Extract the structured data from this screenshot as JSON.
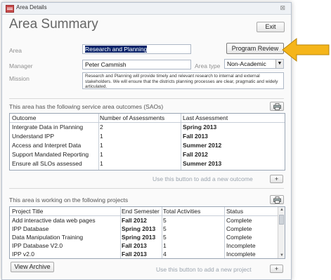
{
  "window": {
    "title": "Area Details",
    "close_glyph": "⊠"
  },
  "form": {
    "title": "Area Summary",
    "exit_label": "Exit",
    "program_review_label": "Program Review",
    "area_label": "Area",
    "area_value": "Research and Planning",
    "manager_label": "Manager",
    "manager_value": "Peter Cammish",
    "area_type_label": "Area type",
    "area_type_value": "Non-Academic",
    "mission_label": "Mission",
    "mission_value": "Research and Planning will provide timely and relevant research to internal and external stakeholders. We will ensure that the districts planning processes are clear, pragmatic and widely articulated."
  },
  "outcomes": {
    "section_title": "This area has the following service area outcomes (SAOs)",
    "columns": [
      "Outcome",
      "Number of Assessments",
      "Last Assessment"
    ],
    "rows": [
      [
        "Intergrate Data in Planning",
        "2",
        "Spring 2013"
      ],
      [
        "Understand IPP",
        "1",
        "Fall 2013"
      ],
      [
        "Access and Interpret Data",
        "1",
        "Summer 2012"
      ],
      [
        "Support Mandated Reporting",
        "1",
        "Fall 2012"
      ],
      [
        "Ensure all SLOs assessed",
        "1",
        "Summer 2013"
      ]
    ],
    "add_hint": "Use this button to add a new outcome",
    "add_label": "+"
  },
  "projects": {
    "section_title": "This area is working on the following projects",
    "columns": [
      "Project Title",
      "End Semester",
      "Total Activities",
      "Status"
    ],
    "rows": [
      [
        "Add interactive data web pages",
        "Fall 2012",
        "5",
        "Complete"
      ],
      [
        "IPP Database",
        "Spring 2013",
        "5",
        "Complete"
      ],
      [
        "Data Manipulation Training",
        "Spring 2013",
        "5",
        "Complete"
      ],
      [
        "IPP Database V2.0",
        "Fall 2013",
        "1",
        "Incomplete"
      ],
      [
        "IPP v2.0",
        "Fall 2013",
        "4",
        "Incomplete"
      ]
    ],
    "view_archive_label": "View Archive",
    "add_hint": "Use this button to add a new project",
    "add_label": "+"
  },
  "icons": {
    "app": "form-icon",
    "print": "printer-icon",
    "combo": "chevron-down-icon",
    "callout": "arrow-left-icon"
  },
  "colors": {
    "callout_arrow": "#f5b51a",
    "selection_bg": "#0a246a"
  }
}
